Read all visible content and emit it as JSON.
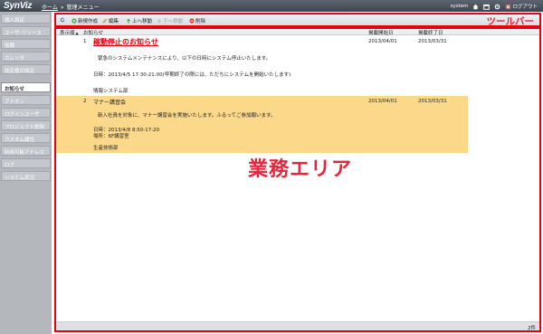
{
  "header": {
    "logo": "SynViz",
    "breadcrumb_home": "ホーム",
    "breadcrumb_sep": "»",
    "breadcrumb_current": "管理メニュー",
    "user": "system",
    "logout": "ログアウト"
  },
  "sidebar": {
    "items": [
      {
        "label": "個人設定",
        "active": false
      },
      {
        "label": "ユーザ･リソース",
        "active": false
      },
      {
        "label": "役職",
        "active": false
      },
      {
        "label": "カレンダ",
        "active": false
      },
      {
        "label": "既定値の設定",
        "active": false
      },
      {
        "label": "お知らせ",
        "active": true
      },
      {
        "label": "アドオン",
        "active": false
      },
      {
        "label": "ログインユーザ",
        "active": false
      },
      {
        "label": "プロジェクト削除",
        "active": false
      },
      {
        "label": "カスタム属性",
        "active": false
      },
      {
        "label": "利用可能アドレス",
        "active": false
      },
      {
        "label": "ログ",
        "active": false
      },
      {
        "label": "システム状況",
        "active": false
      }
    ]
  },
  "toolbar": {
    "new_label": "新規作成",
    "edit_label": "編集",
    "up_label": "上へ移動",
    "down_label": "下へ移動",
    "delete_label": "削除",
    "annotation": "ツールバー"
  },
  "table": {
    "columns": [
      "表示順",
      "お知らせ",
      "掲載開始日",
      "掲載終了日"
    ],
    "sort_indicator": "▲",
    "rows": [
      {
        "order": "1",
        "title": "稼動停止のお知らせ",
        "lines": [
          "緊急のシステムメンテナンスにより、以下の日時にシステム停止いたします。",
          "日時：2013/4/5 17:30-21:00(早期終了の際には、ただちにシステムを開始いたします)",
          "情報システム部"
        ],
        "start": "2013/04/01",
        "end": "2013/03/31",
        "highlight": false
      },
      {
        "order": "2",
        "title": "マナー講習会",
        "lines": [
          "新入社員を対象に、マナー講習会を実施いたします。ふるってご参加願います。",
          "日時：2013/4/8 8:50-17:20",
          "場所：6F講習室",
          "生産技術部"
        ],
        "start": "2013/04/01",
        "end": "2013/03/31",
        "highlight": true
      }
    ]
  },
  "work_area_annotation": "業務エリア",
  "footer": {
    "count": "2件"
  },
  "colors": {
    "annotation": "#e8243a",
    "highlight_row": "#fcd98a",
    "frame": "#e50012"
  }
}
